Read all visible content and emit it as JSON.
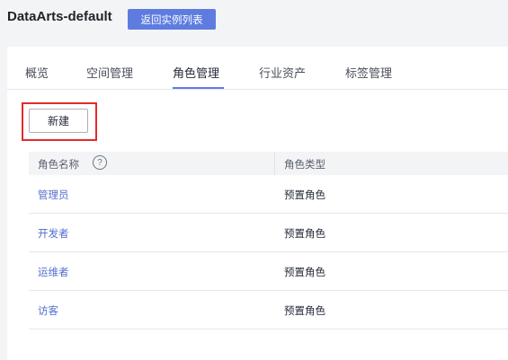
{
  "header": {
    "title": "DataArts-default",
    "back_button": "返回实例列表"
  },
  "tabs": [
    {
      "label": "概览"
    },
    {
      "label": "空间管理"
    },
    {
      "label": "角色管理",
      "active": true
    },
    {
      "label": "行业资产"
    },
    {
      "label": "标签管理"
    }
  ],
  "toolbar": {
    "new_button": "新建"
  },
  "table": {
    "columns": {
      "name": "角色名称",
      "type": "角色类型",
      "help_glyph": "?"
    },
    "rows": [
      {
        "name": "管理员",
        "type": "预置角色"
      },
      {
        "name": "开发者",
        "type": "预置角色"
      },
      {
        "name": "运维者",
        "type": "预置角色"
      },
      {
        "name": "访客",
        "type": "预置角色"
      }
    ]
  },
  "colors": {
    "accent": "#5e7ce0",
    "link": "#526ecc",
    "highlight_border": "#e32a2a"
  }
}
